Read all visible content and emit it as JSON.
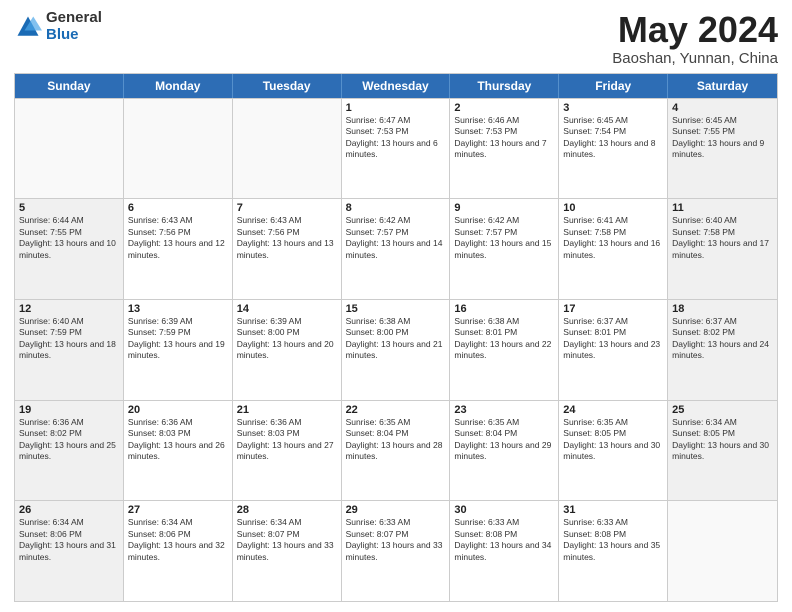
{
  "logo": {
    "general": "General",
    "blue": "Blue"
  },
  "title": {
    "month_year": "May 2024",
    "location": "Baoshan, Yunnan, China"
  },
  "days_of_week": [
    "Sunday",
    "Monday",
    "Tuesday",
    "Wednesday",
    "Thursday",
    "Friday",
    "Saturday"
  ],
  "weeks": [
    [
      {
        "day": "",
        "empty": true
      },
      {
        "day": "",
        "empty": true
      },
      {
        "day": "",
        "empty": true
      },
      {
        "day": "1",
        "sunrise": "6:47 AM",
        "sunset": "7:53 PM",
        "daylight": "13 hours and 6 minutes."
      },
      {
        "day": "2",
        "sunrise": "6:46 AM",
        "sunset": "7:53 PM",
        "daylight": "13 hours and 7 minutes."
      },
      {
        "day": "3",
        "sunrise": "6:45 AM",
        "sunset": "7:54 PM",
        "daylight": "13 hours and 8 minutes."
      },
      {
        "day": "4",
        "sunrise": "6:45 AM",
        "sunset": "7:55 PM",
        "daylight": "13 hours and 9 minutes."
      }
    ],
    [
      {
        "day": "5",
        "sunrise": "6:44 AM",
        "sunset": "7:55 PM",
        "daylight": "13 hours and 10 minutes."
      },
      {
        "day": "6",
        "sunrise": "6:43 AM",
        "sunset": "7:56 PM",
        "daylight": "13 hours and 12 minutes."
      },
      {
        "day": "7",
        "sunrise": "6:43 AM",
        "sunset": "7:56 PM",
        "daylight": "13 hours and 13 minutes."
      },
      {
        "day": "8",
        "sunrise": "6:42 AM",
        "sunset": "7:57 PM",
        "daylight": "13 hours and 14 minutes."
      },
      {
        "day": "9",
        "sunrise": "6:42 AM",
        "sunset": "7:57 PM",
        "daylight": "13 hours and 15 minutes."
      },
      {
        "day": "10",
        "sunrise": "6:41 AM",
        "sunset": "7:58 PM",
        "daylight": "13 hours and 16 minutes."
      },
      {
        "day": "11",
        "sunrise": "6:40 AM",
        "sunset": "7:58 PM",
        "daylight": "13 hours and 17 minutes."
      }
    ],
    [
      {
        "day": "12",
        "sunrise": "6:40 AM",
        "sunset": "7:59 PM",
        "daylight": "13 hours and 18 minutes."
      },
      {
        "day": "13",
        "sunrise": "6:39 AM",
        "sunset": "7:59 PM",
        "daylight": "13 hours and 19 minutes."
      },
      {
        "day": "14",
        "sunrise": "6:39 AM",
        "sunset": "8:00 PM",
        "daylight": "13 hours and 20 minutes."
      },
      {
        "day": "15",
        "sunrise": "6:38 AM",
        "sunset": "8:00 PM",
        "daylight": "13 hours and 21 minutes."
      },
      {
        "day": "16",
        "sunrise": "6:38 AM",
        "sunset": "8:01 PM",
        "daylight": "13 hours and 22 minutes."
      },
      {
        "day": "17",
        "sunrise": "6:37 AM",
        "sunset": "8:01 PM",
        "daylight": "13 hours and 23 minutes."
      },
      {
        "day": "18",
        "sunrise": "6:37 AM",
        "sunset": "8:02 PM",
        "daylight": "13 hours and 24 minutes."
      }
    ],
    [
      {
        "day": "19",
        "sunrise": "6:36 AM",
        "sunset": "8:02 PM",
        "daylight": "13 hours and 25 minutes."
      },
      {
        "day": "20",
        "sunrise": "6:36 AM",
        "sunset": "8:03 PM",
        "daylight": "13 hours and 26 minutes."
      },
      {
        "day": "21",
        "sunrise": "6:36 AM",
        "sunset": "8:03 PM",
        "daylight": "13 hours and 27 minutes."
      },
      {
        "day": "22",
        "sunrise": "6:35 AM",
        "sunset": "8:04 PM",
        "daylight": "13 hours and 28 minutes."
      },
      {
        "day": "23",
        "sunrise": "6:35 AM",
        "sunset": "8:04 PM",
        "daylight": "13 hours and 29 minutes."
      },
      {
        "day": "24",
        "sunrise": "6:35 AM",
        "sunset": "8:05 PM",
        "daylight": "13 hours and 30 minutes."
      },
      {
        "day": "25",
        "sunrise": "6:34 AM",
        "sunset": "8:05 PM",
        "daylight": "13 hours and 30 minutes."
      }
    ],
    [
      {
        "day": "26",
        "sunrise": "6:34 AM",
        "sunset": "8:06 PM",
        "daylight": "13 hours and 31 minutes."
      },
      {
        "day": "27",
        "sunrise": "6:34 AM",
        "sunset": "8:06 PM",
        "daylight": "13 hours and 32 minutes."
      },
      {
        "day": "28",
        "sunrise": "6:34 AM",
        "sunset": "8:07 PM",
        "daylight": "13 hours and 33 minutes."
      },
      {
        "day": "29",
        "sunrise": "6:33 AM",
        "sunset": "8:07 PM",
        "daylight": "13 hours and 33 minutes."
      },
      {
        "day": "30",
        "sunrise": "6:33 AM",
        "sunset": "8:08 PM",
        "daylight": "13 hours and 34 minutes."
      },
      {
        "day": "31",
        "sunrise": "6:33 AM",
        "sunset": "8:08 PM",
        "daylight": "13 hours and 35 minutes."
      },
      {
        "day": "",
        "empty": true
      }
    ]
  ]
}
